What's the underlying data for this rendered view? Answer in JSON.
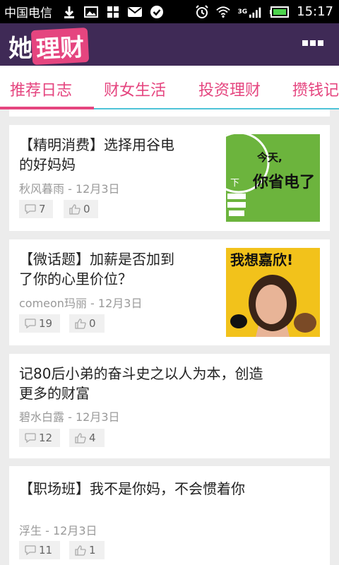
{
  "status_bar": {
    "carrier": "中国电信",
    "network": "3G",
    "time": "15:17",
    "icons_left": [
      "download-icon",
      "image-icon",
      "grid-icon",
      "mail-icon",
      "check-icon"
    ],
    "icons_right": [
      "alarm-icon",
      "wifi-icon",
      "signal-icon",
      "battery-icon"
    ]
  },
  "app": {
    "logo_part1": "她",
    "logo_part2": "理财",
    "brand_color": "#3f2a56",
    "accent_color": "#e5457f"
  },
  "tabs": [
    {
      "label": "推荐日志",
      "active": true
    },
    {
      "label": "财女生活",
      "active": false
    },
    {
      "label": "投资理财",
      "active": false
    },
    {
      "label": "攒钱记",
      "active": false
    }
  ],
  "articles": [
    {
      "title_line1": "【精明消费】选择用谷电",
      "title_line2": "的好妈妈",
      "author": "秋风暮雨",
      "date": "12月3日",
      "comments": "7",
      "likes": "0",
      "thumb_text_top": "今天,",
      "thumb_text_bottom": "你省电了"
    },
    {
      "title_line1": "【微话题】加薪是否加到",
      "title_line2": "了你的心里价位？",
      "author": "comeon玛丽",
      "date": "12月3日",
      "comments": "19",
      "likes": "0",
      "thumb_text_top": "我想嘉欣!"
    },
    {
      "title_line1": "记80后小弟的奋斗史之以人为本，创造",
      "title_line2": "更多的财富",
      "author": "碧水白露",
      "date": "12月3日",
      "comments": "12",
      "likes": "4"
    },
    {
      "title_line1": "【职场班】我不是你妈，不会惯着你",
      "title_line2": "",
      "author": "浮生",
      "date": "12月3日",
      "comments": "11",
      "likes": "1"
    }
  ],
  "meta_separator": " - "
}
